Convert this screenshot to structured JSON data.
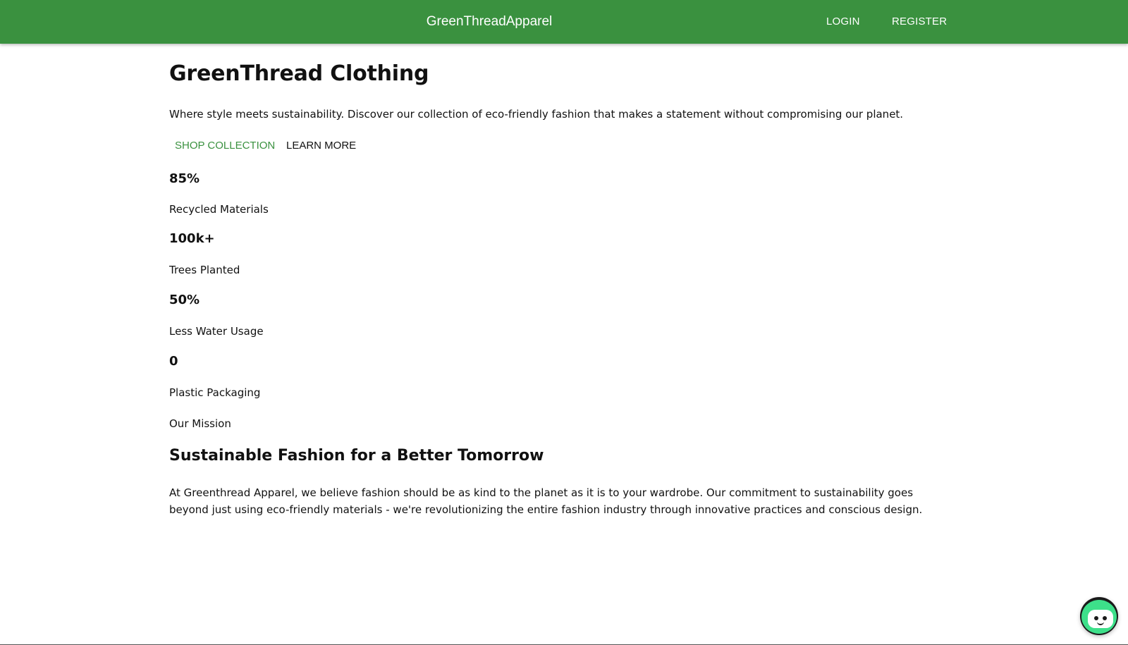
{
  "header": {
    "brand": "GreenThreadApparel",
    "nav": {
      "login": "LOGIN",
      "register": "REGISTER"
    }
  },
  "hero": {
    "title": "GreenThread Clothing",
    "subtitle": "Where style meets sustainability. Discover our collection of eco-friendly fashion that makes a statement without compromising our planet.",
    "shop_button": "SHOP COLLECTION",
    "learn_button": "LEARN MORE"
  },
  "stats": [
    {
      "value": "85%",
      "label": "Recycled Materials"
    },
    {
      "value": "100k+",
      "label": "Trees Planted"
    },
    {
      "value": "50%",
      "label": "Less Water Usage"
    },
    {
      "value": "0",
      "label": "Plastic Packaging"
    }
  ],
  "mission": {
    "label": "Our Mission",
    "title": "Sustainable Fashion for a Better Tomorrow",
    "text": "At Greenthread Apparel, we believe fashion should be as kind to the planet as it is to your wardrobe. Our commitment to sustainability goes beyond just using eco-friendly materials - we're revolutionizing the entire fashion industry through innovative practices and conscious design."
  },
  "chat_widget": {
    "icon": "chatbot-icon"
  },
  "colors": {
    "primary": "#3a913f",
    "header_text": "#ffffff",
    "body_text": "#111111",
    "chat_accent": "#3de08a"
  }
}
